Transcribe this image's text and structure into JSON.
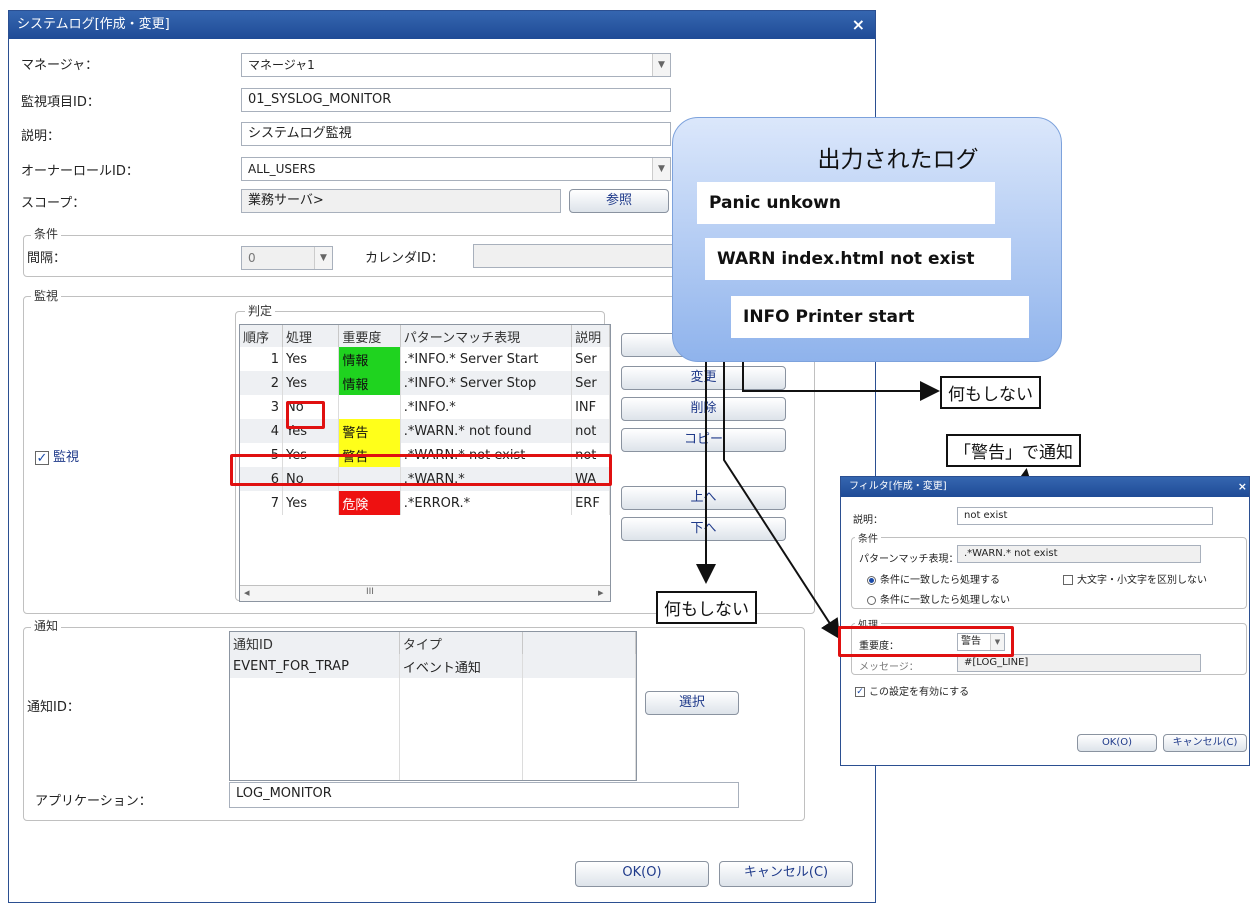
{
  "dialog": {
    "title": "システムログ[作成・変更]",
    "close_glyph": "×",
    "manager": {
      "label": "マネージャ：",
      "value": "マネージャ1"
    },
    "monitor_id": {
      "label": "監視項目ID：",
      "value": "01_SYSLOG_MONITOR"
    },
    "description": {
      "label": "説明：",
      "value": "システムログ監視"
    },
    "owner_role": {
      "label": "オーナーロールID：",
      "value": "ALL_USERS"
    },
    "scope": {
      "label": "スコープ：",
      "value": "業務サーバ>",
      "browse_button": "参照"
    },
    "conditions": {
      "title": "条件",
      "interval_label": "間隔：",
      "interval_value": "0",
      "calendar_label": "カレンダID："
    },
    "monitoring": {
      "title": "監視",
      "checkbox_label": "監視",
      "judgement_title": "判定",
      "columns": [
        "順序",
        "処理",
        "重要度",
        "パターンマッチ表現",
        "説明"
      ],
      "rows": [
        {
          "order": "1",
          "process": "Yes",
          "severity": "情報",
          "pattern": ".*INFO.* Server Start",
          "desc": "Ser"
        },
        {
          "order": "2",
          "process": "Yes",
          "severity": "情報",
          "pattern": ".*INFO.* Server Stop",
          "desc": "Ser"
        },
        {
          "order": "3",
          "process": "No",
          "severity": "",
          "pattern": ".*INFO.*",
          "desc": "INF"
        },
        {
          "order": "4",
          "process": "Yes",
          "severity": "警告",
          "pattern": ".*WARN.* not found",
          "desc": "not"
        },
        {
          "order": "5",
          "process": "Yes",
          "severity": "警告",
          "pattern": ".*WARN.* not exist",
          "desc": "not"
        },
        {
          "order": "6",
          "process": "No",
          "severity": "",
          "pattern": ".*WARN.*",
          "desc": "WA"
        },
        {
          "order": "7",
          "process": "Yes",
          "severity": "危険",
          "pattern": ".*ERROR.*",
          "desc": "ERF"
        }
      ],
      "buttons": {
        "modify": "変更",
        "delete": "削除",
        "copy": "コピー",
        "up": "上へ",
        "down": "下へ"
      },
      "scroll_left": "◂",
      "scroll_thumb": "III",
      "scroll_right": "▸"
    },
    "notification": {
      "title": "通知",
      "label": "通知ID：",
      "columns": [
        "通知ID",
        "タイプ"
      ],
      "rows": [
        {
          "id": "EVENT_FOR_TRAP",
          "type": "イベント通知"
        }
      ],
      "select_button": "選択",
      "application_label": "アプリケーション：",
      "application_value": "LOG_MONITOR"
    },
    "ok_button": "OK(O)",
    "cancel_button": "キャンセル(C)"
  },
  "callout": {
    "title": "出力されたログ",
    "lines": [
      "Panic unkown",
      "WARN index.html not exist",
      "INFO Printer start"
    ]
  },
  "notes": {
    "nothing_1": "何もしない",
    "nothing_2": "何もしない",
    "notify_warn": "「警告」で通知"
  },
  "filter": {
    "title": "フィルタ[作成・変更]",
    "close_glyph": "×",
    "description_label": "説明：",
    "description_value": "not exist",
    "condition_title": "条件",
    "pattern_label": "パターンマッチ表現：",
    "pattern_value": ".*WARN.* not exist",
    "radio_match": "条件に一致したら処理する",
    "radio_nomatch": "条件に一致したら処理しない",
    "case_label": "大文字・小文字を区別しない",
    "process_title": "処理",
    "severity_label": "重要度：",
    "severity_value": "警告",
    "message_label": "メッセージ：",
    "message_value": "#[LOG_LINE]",
    "enable_label": "この設定を有効にする",
    "ok_button": "OK(O)",
    "cancel_button": "キャンセル(C)"
  },
  "colors": {
    "title_bar": "#1f4b96",
    "info": "#1fd31f",
    "warning": "#ffff1a",
    "critical": "#ee1111",
    "highlight": "#e01010"
  }
}
